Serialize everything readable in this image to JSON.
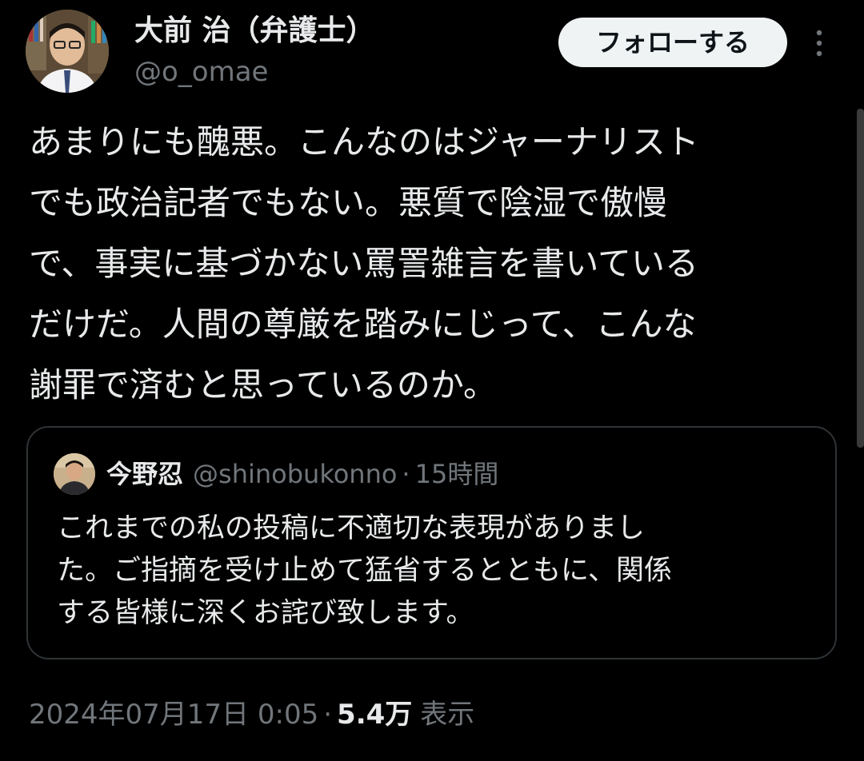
{
  "author": {
    "display_name": "大前 治（弁護士）",
    "handle": "@o_omae"
  },
  "follow_button_label": "フォローする",
  "tweet_lines": [
    "あまりにも醜悪。こんなのはジャーナリスト",
    "でも政治記者でもない。悪質で陰湿で傲慢",
    "で、事実に基づかない罵詈雑言を書いている",
    "だけだ。人間の尊厳を踏みにじって、こんな",
    "謝罪で済むと思っているのか。"
  ],
  "quoted_tweet": {
    "display_name": "今野忍",
    "handle": "@shinobukonno",
    "separator": "·",
    "time": "15時間",
    "lines": [
      "これまでの私の投稿に不適切な表現がありまし",
      "た。ご指摘を受け止めて猛省するとともに、関係",
      "する皆様に深くお詫び致します。"
    ]
  },
  "meta": {
    "timestamp": "2024年07月17日 0:05",
    "separator": "·",
    "views_count": "5.4万",
    "views_label": "表示"
  },
  "icons": {
    "more": "more-vertical-icon"
  },
  "colors": {
    "background": "#000000",
    "primary_text": "#e7e9ea",
    "secondary_text": "#71767b",
    "border": "#2f3336",
    "follow_button_bg": "#eff3f4",
    "follow_button_text": "#0f1419"
  }
}
